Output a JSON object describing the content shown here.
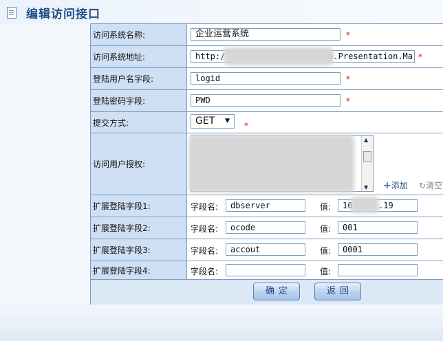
{
  "header": {
    "title": "编辑访问接口",
    "icon": "document-icon"
  },
  "fields": {
    "system_name": {
      "label": "访问系统名称:",
      "value": "企业运营系统"
    },
    "system_url": {
      "label": "访问系统地址:",
      "value_start": "http:/",
      "value_end": "6.Presentation.Ma"
    },
    "username_field": {
      "label": "登陆用户名字段:",
      "value": "logid"
    },
    "password_field": {
      "label": "登陆密码字段:",
      "value": "PWD"
    },
    "submit_method": {
      "label": "提交方式:",
      "value": "GET"
    },
    "user_auth": {
      "label": "访问用户授权:",
      "add": "添加",
      "clear": "清空"
    },
    "ext": [
      {
        "label": "扩展登陆字段1:",
        "name_label": "字段名:",
        "name": "dbserver",
        "value_label": "值:",
        "value_start": "10",
        "value_end": ".19"
      },
      {
        "label": "扩展登陆字段2:",
        "name_label": "字段名:",
        "name": "ocode",
        "value_label": "值:",
        "value": "001"
      },
      {
        "label": "扩展登陆字段3:",
        "name_label": "字段名:",
        "name": "accout",
        "value_label": "值:",
        "value": "0001"
      },
      {
        "label": "扩展登陆字段4:",
        "name_label": "字段名:",
        "name": "",
        "value_label": "值:",
        "value": ""
      }
    ]
  },
  "required_mark": "*",
  "buttons": {
    "confirm": "确定",
    "back": "返回"
  },
  "colors": {
    "label_bg": "#cfe0f4",
    "border": "#7a9cc2",
    "title": "#1f4e86",
    "required": "#d01010"
  }
}
